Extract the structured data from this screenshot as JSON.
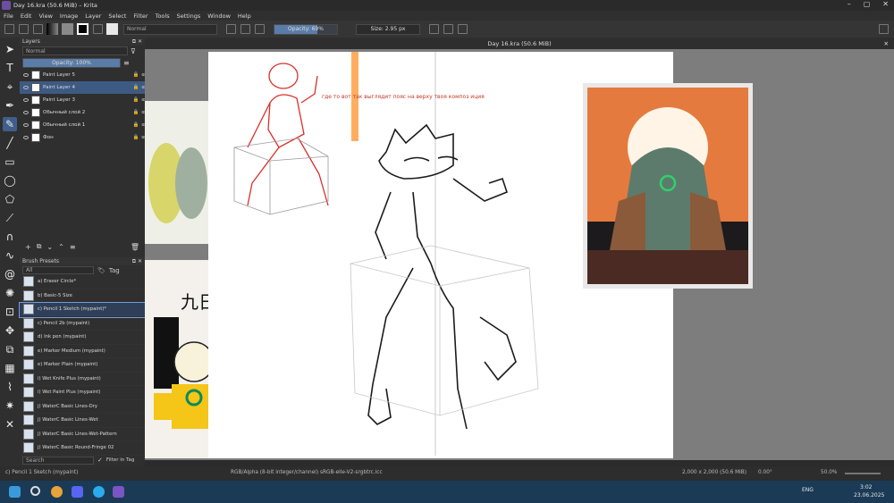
{
  "window": {
    "title": "Day 16.kra (50.6 MiB) – Krita"
  },
  "menu": [
    "File",
    "Edit",
    "View",
    "Image",
    "Layer",
    "Select",
    "Filter",
    "Tools",
    "Settings",
    "Window",
    "Help"
  ],
  "toolbar": {
    "blend_mode": "Normal",
    "opacity": "Opacity: 69%",
    "opacity_fraction": 0.69,
    "size": "Size: 2.95 px",
    "colors": {
      "accent": "#5a7ca8",
      "fg": "#000000",
      "bg": "#ffffff"
    }
  },
  "document_tab": {
    "label": "Day 16.kra (50.6 MiB)"
  },
  "layers": {
    "title": "Layers",
    "blend_mode": "Normal",
    "opacity": "Opacity: 100%",
    "items": [
      {
        "name": "Paint Layer 5",
        "selected": false
      },
      {
        "name": "Paint Layer 4",
        "selected": true
      },
      {
        "name": "Paint Layer 3",
        "selected": false
      },
      {
        "name": "Обычный слой 2",
        "selected": false
      },
      {
        "name": "Обычный слой 1",
        "selected": false
      },
      {
        "name": "Фон",
        "selected": false
      }
    ]
  },
  "brush_presets": {
    "title": "Brush Presets",
    "filter": "All",
    "tag_label": "Tag",
    "search_placeholder": "Search",
    "filter_in_tag": "Filter in Tag",
    "items": [
      {
        "name": "a) Eraser Circle*",
        "selected": false
      },
      {
        "name": "b) Basic-5 Size",
        "selected": false
      },
      {
        "name": "c) Pencil 1 Sketch (mypaint)*",
        "selected": true
      },
      {
        "name": "c) Pencil 2b (mypaint)",
        "selected": false
      },
      {
        "name": "d) Ink pen (mypaint)",
        "selected": false
      },
      {
        "name": "e) Marker Medium (mypaint)",
        "selected": false
      },
      {
        "name": "e) Marker Plain (mypaint)",
        "selected": false
      },
      {
        "name": "i) Wet Knife Plus (mypaint)",
        "selected": false
      },
      {
        "name": "i) Wet Paint Plus (mypaint)",
        "selected": false
      },
      {
        "name": "j) WaterC Basic Lines-Dry",
        "selected": false
      },
      {
        "name": "j) WaterC Basic Lines-Wet",
        "selected": false
      },
      {
        "name": "j) WaterC Basic Lines-Wet-Pattern",
        "selected": false
      },
      {
        "name": "j) WaterC Basic Round-Fringe 02",
        "selected": false
      }
    ]
  },
  "canvas": {
    "notes_text": "где то вот так выглядит\nпояс\nна\nверху\nтвоя\nкомпоз\nиция",
    "sticker_text": "九日"
  },
  "statusbar": {
    "brush": "c) Pencil 1 Sketch (mypaint)",
    "color_info": "RGB/Alpha (8-bit integer/channel)  sRGB-elle-V2-srgbtrc.icc",
    "dimensions": "2,000 x 2,000 (50.6 MiB)",
    "rotation": "0.00°",
    "zoom": "50.0%"
  },
  "taskbar": {
    "lang": "ENG",
    "time": "3:02",
    "date": "23.06.2025"
  }
}
